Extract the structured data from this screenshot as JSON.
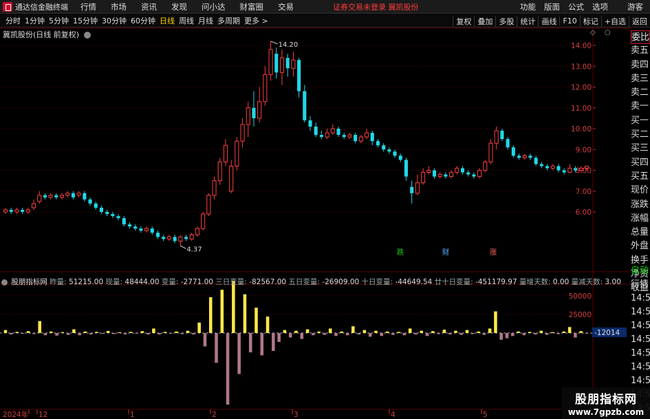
{
  "menubar": {
    "app_title": "通达信金融终端",
    "items": [
      "行情",
      "市场",
      "资讯",
      "发现",
      "问小达",
      "财富圈",
      "交易"
    ],
    "notice": "证券交易未登录  冀凯股份",
    "right_items": [
      "功能",
      "版面",
      "公式",
      "选项"
    ],
    "guest": "游客"
  },
  "toolbar": {
    "periods": [
      "分时",
      "1分钟",
      "5分钟",
      "15分钟",
      "30分钟",
      "60分钟",
      "日线",
      "周线",
      "月线",
      "多周期",
      "更多 >"
    ],
    "active_period": "日线",
    "right_buttons": [
      "复权",
      "叠加",
      "多股",
      "统计",
      "画线",
      "F10",
      "标记",
      "+自选",
      "返回"
    ]
  },
  "stock": {
    "title": "冀凯股份(日线 前复权)",
    "high_label": "14.20",
    "low_label": "4.37"
  },
  "price_axis": [
    "14.00",
    "13.00",
    "12.00",
    "11.00",
    "10.00",
    "9.00",
    "8.00",
    "7.00",
    "6.00"
  ],
  "side_panel": [
    "委比",
    "卖五",
    "卖四",
    "卖三",
    "卖二",
    "卖一",
    "买一",
    "买二",
    "买三",
    "买四",
    "买五",
    "现价",
    "涨跌",
    "涨幅",
    "总量",
    "外盘",
    "换手",
    "净资",
    "收益"
  ],
  "side_panel2": [
    {
      "text": "自动",
      "tone": "green"
    },
    {
      "text": "行情",
      "tone": "gray"
    },
    {
      "text": "14:56",
      "tone": "gray"
    },
    {
      "text": "14:56",
      "tone": "gray"
    },
    {
      "text": "14:56",
      "tone": "gray"
    },
    {
      "text": "14:56",
      "tone": "gray"
    },
    {
      "text": "14:56",
      "tone": "gray"
    },
    {
      "text": "14:56",
      "tone": "gray"
    },
    {
      "text": "14:56",
      "tone": "gray"
    },
    {
      "text": "14:56",
      "tone": "gray"
    },
    {
      "text": "14:56",
      "tone": "gray"
    }
  ],
  "markers": [
    {
      "text": "跌",
      "color": "#00c800"
    },
    {
      "text": "财",
      "color": "#4aa0ff"
    },
    {
      "text": "涨",
      "color": "#ff5050"
    }
  ],
  "indicator": {
    "name": "股朋指标网",
    "fields": [
      {
        "k": "昨量:",
        "v": "51215.00"
      },
      {
        "k": "现量:",
        "v": "48444.00"
      },
      {
        "k": "变量:",
        "v": "-2771.00"
      },
      {
        "k": "三日变量:",
        "v": "-82567.00"
      },
      {
        "k": "五日变量:",
        "v": "-26909.00"
      },
      {
        "k": "十日变量:",
        "v": "-44649.54"
      },
      {
        "k": "廿十日变量:",
        "v": "-451179.97"
      },
      {
        "k": "量增天数:",
        "v": "0.00"
      },
      {
        "k": "量减天数:",
        "v": "3.00"
      }
    ],
    "axis": [
      "50000",
      "25000"
    ],
    "current_value": "-12014"
  },
  "time_axis": [
    "2024年",
    "12",
    "1",
    "2",
    "3",
    "4",
    "5"
  ],
  "watermark": {
    "line1": "股朋指标网",
    "line2": "www.7gpzb.com"
  },
  "colors": {
    "up": "#ff4040",
    "down": "#20d8e8",
    "vol_up": "#ffe84a",
    "vol_down": "#b07888",
    "grid": "#5a0000"
  },
  "chart_data": {
    "type": "candlestick",
    "title": "冀凯股份(日线 前复权)",
    "ylim": [
      4.0,
      14.5
    ],
    "candles": [
      [
        6.0,
        6.1,
        6.2,
        5.9
      ],
      [
        6.1,
        6.0,
        6.2,
        5.9
      ],
      [
        6.0,
        6.1,
        6.2,
        5.9
      ],
      [
        6.1,
        6.0,
        6.2,
        5.9
      ],
      [
        6.0,
        6.1,
        6.2,
        5.9
      ],
      [
        6.2,
        6.4,
        6.6,
        6.1
      ],
      [
        6.5,
        6.8,
        7.0,
        6.4
      ],
      [
        6.8,
        6.7,
        6.9,
        6.6
      ],
      [
        6.7,
        6.8,
        6.9,
        6.6
      ],
      [
        6.8,
        6.7,
        6.9,
        6.6
      ],
      [
        6.7,
        6.8,
        6.9,
        6.6
      ],
      [
        6.8,
        6.9,
        7.0,
        6.7
      ],
      [
        6.9,
        6.7,
        7.0,
        6.6
      ],
      [
        6.8,
        6.9,
        7.0,
        6.7
      ],
      [
        6.9,
        6.6,
        7.0,
        6.5
      ],
      [
        6.6,
        6.4,
        6.7,
        6.3
      ],
      [
        6.4,
        6.2,
        6.5,
        6.1
      ],
      [
        6.2,
        6.0,
        6.3,
        5.9
      ],
      [
        6.0,
        5.9,
        6.1,
        5.8
      ],
      [
        5.9,
        5.8,
        6.0,
        5.7
      ],
      [
        5.8,
        5.7,
        5.9,
        5.6
      ],
      [
        5.7,
        5.4,
        5.8,
        5.3
      ],
      [
        5.4,
        5.3,
        5.5,
        5.2
      ],
      [
        5.3,
        5.2,
        5.4,
        5.1
      ],
      [
        5.2,
        5.1,
        5.3,
        5.0
      ],
      [
        5.1,
        5.2,
        5.3,
        5.0
      ],
      [
        5.2,
        5.0,
        5.3,
        4.9
      ],
      [
        5.0,
        4.8,
        5.1,
        4.7
      ],
      [
        4.8,
        4.7,
        4.9,
        4.6
      ],
      [
        4.7,
        4.8,
        4.9,
        4.6
      ],
      [
        4.8,
        4.6,
        4.9,
        4.5
      ],
      [
        4.6,
        4.8,
        4.9,
        4.37
      ],
      [
        4.8,
        4.7,
        4.9,
        4.6
      ],
      [
        4.7,
        4.9,
        5.0,
        4.6
      ],
      [
        4.9,
        5.2,
        5.3,
        4.8
      ],
      [
        5.2,
        5.9,
        6.0,
        5.1
      ],
      [
        5.9,
        6.8,
        6.9,
        5.8
      ],
      [
        6.8,
        7.5,
        7.7,
        6.6
      ],
      [
        7.5,
        8.4,
        8.6,
        7.3
      ],
      [
        8.4,
        9.2,
        9.5,
        8.2
      ],
      [
        7.0,
        8.2,
        8.5,
        6.9
      ],
      [
        8.2,
        9.4,
        9.6,
        8.0
      ],
      [
        9.4,
        10.2,
        10.5,
        9.1
      ],
      [
        10.2,
        11.0,
        11.3,
        9.6
      ],
      [
        11.0,
        10.5,
        11.8,
        10.1
      ],
      [
        10.5,
        11.3,
        12.0,
        10.3
      ],
      [
        11.3,
        12.6,
        13.0,
        11.1
      ],
      [
        12.6,
        13.8,
        14.2,
        12.3
      ],
      [
        13.6,
        12.7,
        13.9,
        12.4
      ],
      [
        12.7,
        13.4,
        13.8,
        12.1
      ],
      [
        13.4,
        12.9,
        13.6,
        12.5
      ],
      [
        12.9,
        13.3,
        13.7,
        12.5
      ],
      [
        13.3,
        11.8,
        13.4,
        11.5
      ],
      [
        11.8,
        10.4,
        12.1,
        10.3
      ],
      [
        10.4,
        10.1,
        10.6,
        9.9
      ],
      [
        10.1,
        9.7,
        10.3,
        9.6
      ],
      [
        9.7,
        9.6,
        9.9,
        9.5
      ],
      [
        9.6,
        9.8,
        10.0,
        9.5
      ],
      [
        9.8,
        10.0,
        10.2,
        9.7
      ],
      [
        10.0,
        9.7,
        10.1,
        9.6
      ],
      [
        9.7,
        9.6,
        9.8,
        9.5
      ],
      [
        9.6,
        9.7,
        9.8,
        9.5
      ],
      [
        9.7,
        9.4,
        9.8,
        9.3
      ],
      [
        9.4,
        9.6,
        9.7,
        9.3
      ],
      [
        9.6,
        9.8,
        10.0,
        9.5
      ],
      [
        9.8,
        9.4,
        9.9,
        9.2
      ],
      [
        9.4,
        9.2,
        9.5,
        9.1
      ],
      [
        9.2,
        9.0,
        9.3,
        8.9
      ],
      [
        9.0,
        8.9,
        9.1,
        8.8
      ],
      [
        8.9,
        8.7,
        9.0,
        8.6
      ],
      [
        8.7,
        8.5,
        8.8,
        8.4
      ],
      [
        8.5,
        7.7,
        8.6,
        7.5
      ],
      [
        7.2,
        6.9,
        7.5,
        6.4
      ],
      [
        6.9,
        7.4,
        7.8,
        6.8
      ],
      [
        7.4,
        7.9,
        8.1,
        7.3
      ],
      [
        7.9,
        8.0,
        8.2,
        7.8
      ],
      [
        8.0,
        7.7,
        8.1,
        7.6
      ],
      [
        7.7,
        7.8,
        7.9,
        7.6
      ],
      [
        7.8,
        7.7,
        7.9,
        7.6
      ],
      [
        7.7,
        7.9,
        8.0,
        7.6
      ],
      [
        7.9,
        8.1,
        8.2,
        7.8
      ],
      [
        8.1,
        7.9,
        8.2,
        7.8
      ],
      [
        7.9,
        7.8,
        8.0,
        7.7
      ],
      [
        7.8,
        7.7,
        7.9,
        7.6
      ],
      [
        7.7,
        8.0,
        8.1,
        7.6
      ],
      [
        8.0,
        8.4,
        8.5,
        7.9
      ],
      [
        8.4,
        9.3,
        9.5,
        8.3
      ],
      [
        9.3,
        9.9,
        10.1,
        9.0
      ],
      [
        9.9,
        9.5,
        10.0,
        9.4
      ],
      [
        9.5,
        9.1,
        9.6,
        9.0
      ],
      [
        9.1,
        8.7,
        9.2,
        8.6
      ],
      [
        8.7,
        8.6,
        8.8,
        8.5
      ],
      [
        8.6,
        8.7,
        8.8,
        8.5
      ],
      [
        8.7,
        8.6,
        8.8,
        8.5
      ],
      [
        8.6,
        8.3,
        8.7,
        8.2
      ],
      [
        8.3,
        8.2,
        8.4,
        8.1
      ],
      [
        8.2,
        8.1,
        8.3,
        8.0
      ],
      [
        8.1,
        8.2,
        8.3,
        8.0
      ],
      [
        8.2,
        8.0,
        8.3,
        7.9
      ],
      [
        8.0,
        7.9,
        8.1,
        7.8
      ],
      [
        7.9,
        8.1,
        8.3,
        7.9
      ],
      [
        8.1,
        8.0,
        8.2,
        7.9
      ],
      [
        8.0,
        8.1,
        8.2,
        7.9
      ],
      [
        8.1,
        8.2,
        8.2,
        8.0
      ]
    ],
    "volume_change": [
      4000,
      -2000,
      1500,
      -1000,
      2500,
      -1500,
      16000,
      -3000,
      2000,
      -3500,
      1200,
      -2500,
      5000,
      -3000,
      2000,
      -2000,
      1500,
      -1000,
      2800,
      -1500,
      1000,
      -2000,
      1500,
      -1000,
      2500,
      -2000,
      6000,
      -2000,
      1500,
      -1000,
      2000,
      -1500,
      3000,
      -2000,
      14000,
      -18000,
      48000,
      -40000,
      58000,
      -96000,
      70000,
      -55000,
      52000,
      -26000,
      34000,
      -30000,
      22000,
      -24000,
      -12000,
      4000,
      -6000,
      3000,
      -8000,
      5000,
      -3000,
      2000,
      -2500,
      6000,
      -4000,
      2000,
      -3000,
      9000,
      -2000,
      4000,
      -5000,
      3000,
      -4000,
      2000,
      -2500,
      1500,
      -3000,
      6000,
      -2000,
      3000,
      -4000,
      2500,
      -1500,
      4500,
      -2000,
      3000,
      -2500,
      4000,
      -1500,
      2000,
      -2500,
      6000,
      29000,
      -9000,
      -7000,
      -4000,
      2000,
      -3000,
      1500,
      -2000,
      3000,
      -2500,
      1200,
      -1500,
      2000,
      8000,
      -6000,
      2500,
      -1000
    ]
  }
}
